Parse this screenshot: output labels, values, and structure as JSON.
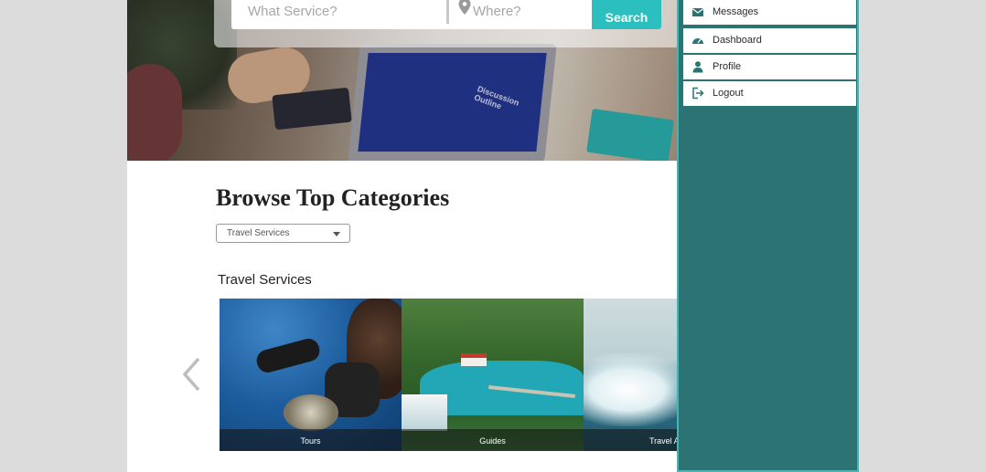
{
  "search": {
    "what_placeholder": "What Service?",
    "where_placeholder": "Where?",
    "button_label": "Search"
  },
  "hero": {
    "screen_text": "Discussion Outline"
  },
  "categories": {
    "title": "Browse Top Categories",
    "dropdown_selected": "Travel Services",
    "section_title": "Travel Services",
    "cards": [
      {
        "label": "Tours"
      },
      {
        "label": "Guides"
      },
      {
        "label": "Travel A"
      }
    ]
  },
  "side_menu": {
    "items": [
      {
        "label": "Messages",
        "icon": "envelope-icon"
      },
      {
        "label": "Dashboard",
        "icon": "dashboard-gauge-icon"
      },
      {
        "label": "Profile",
        "icon": "user-icon"
      },
      {
        "label": "Logout",
        "icon": "logout-icon"
      }
    ]
  },
  "colors": {
    "accent": "#2bbfbf",
    "side_panel": "#2c7373",
    "side_panel_border": "#48b3b3",
    "icon": "#2c7373"
  }
}
